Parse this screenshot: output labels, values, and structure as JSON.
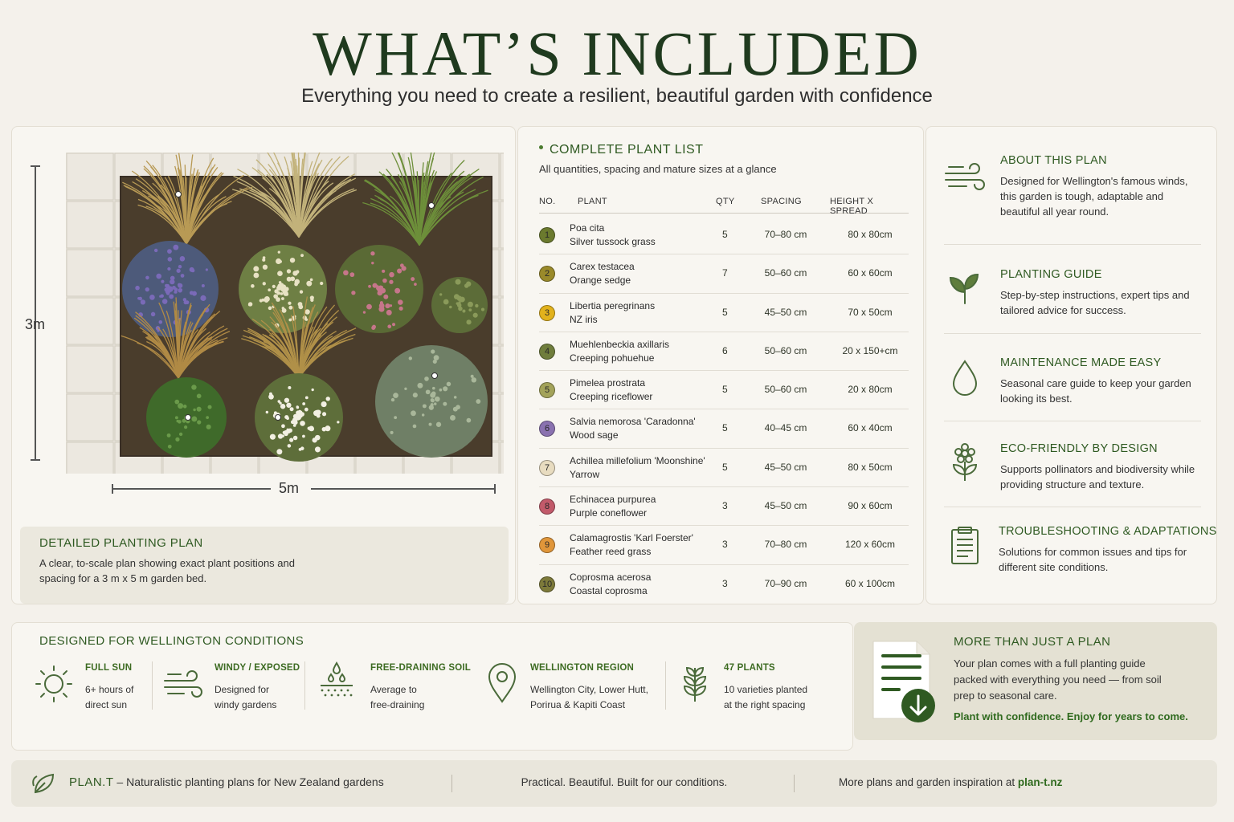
{
  "header": {
    "title": "WHAT’S INCLUDED",
    "subtitle": "Everything you need to create a resilient, beautiful garden with confidence"
  },
  "plan": {
    "dim_vertical": "3m",
    "dim_horizontal": "5m",
    "caption_title": "DETAILED PLANTING PLAN",
    "caption_text": "A clear, to-scale plan showing exact plant positions and spacing for a 3 m x 5 m garden bed."
  },
  "plant_list": {
    "title": "COMPLETE PLANT LIST",
    "subtitle": "All quantities, spacing and mature sizes at a glance",
    "columns": [
      "NO.",
      "PLANT",
      "QTY",
      "SPACING",
      "HEIGHT X SPREAD"
    ],
    "rows": [
      {
        "no": "1",
        "name": "Poa cita",
        "common": "Silver tussock grass",
        "qty": "5",
        "spacing": "70–80 cm",
        "size": "80 x 80cm",
        "color": "#6b7a2e"
      },
      {
        "no": "2",
        "name": "Carex testacea",
        "common": "Orange sedge",
        "qty": "7",
        "spacing": "50–60 cm",
        "size": "60 x 60cm",
        "color": "#9a8a2a"
      },
      {
        "no": "3",
        "name": "Libertia peregrinans",
        "common": "NZ iris",
        "qty": "5",
        "spacing": "45–50 cm",
        "size": "70 x 50cm",
        "color": "#e2b21c"
      },
      {
        "no": "4",
        "name": "Muehlenbeckia axillaris",
        "common": "Creeping pohuehue",
        "qty": "6",
        "spacing": "50–60 cm",
        "size": "20 x 150+cm",
        "color": "#6f7d3c"
      },
      {
        "no": "5",
        "name": "Pimelea prostrata",
        "common": "Creeping riceflower",
        "qty": "5",
        "spacing": "50–60 cm",
        "size": "20 x 80cm",
        "color": "#a3a35a"
      },
      {
        "no": "6",
        "name": "Salvia nemorosa 'Caradonna'",
        "common": "Wood sage",
        "qty": "5",
        "spacing": "40–45 cm",
        "size": "60 x 40cm",
        "color": "#8a72b0"
      },
      {
        "no": "7",
        "name": "Achillea millefolium 'Moonshine'",
        "common": "Yarrow",
        "qty": "5",
        "spacing": "45–50 cm",
        "size": "80 x 50cm",
        "color": "#e8dcc0"
      },
      {
        "no": "8",
        "name": "Echinacea purpurea",
        "common": "Purple coneflower",
        "qty": "3",
        "spacing": "45–50 cm",
        "size": "90 x 60cm",
        "color": "#c25a6a"
      },
      {
        "no": "9",
        "name": "Calamagrostis 'Karl Foerster'",
        "common": "Feather reed grass",
        "qty": "3",
        "spacing": "70–80 cm",
        "size": "120 x 60cm",
        "color": "#e0963a"
      },
      {
        "no": "10",
        "name": "Coprosma acerosa",
        "common": "Coastal coprosma",
        "qty": "3",
        "spacing": "70–90 cm",
        "size": "60 x 100cm",
        "color": "#7d7a3a"
      }
    ]
  },
  "about": [
    {
      "icon": "wind-icon",
      "title": "ABOUT THIS PLAN",
      "text": "Designed for Wellington's famous winds, this garden is tough, adaptable and beautiful all year round."
    },
    {
      "icon": "sprout-icon",
      "title": "PLANTING GUIDE",
      "text": "Step-by-step instructions, expert tips and tailored advice for success."
    },
    {
      "icon": "water-drop-icon",
      "title": "MAINTENANCE MADE EASY",
      "text": "Seasonal care guide to keep your garden looking its best."
    },
    {
      "icon": "flower-icon",
      "title": "ECO-FRIENDLY BY DESIGN",
      "text": "Supports pollinators and biodiversity while providing structure and texture."
    },
    {
      "icon": "clipboard-icon",
      "title": "TROUBLESHOOTING & ADAPTATIONS",
      "text": "Solutions for common issues and tips for different site conditions."
    }
  ],
  "conditions": {
    "title": "DESIGNED FOR WELLINGTON CONDITIONS",
    "items": [
      {
        "icon": "sun-icon",
        "title": "FULL SUN",
        "line1": "6+ hours of",
        "line2": "direct sun"
      },
      {
        "icon": "wind-icon",
        "title": "WINDY / EXPOSED",
        "line1": "Designed for",
        "line2": "windy gardens"
      },
      {
        "icon": "soil-drainage-icon",
        "title": "FREE-DRAINING SOIL",
        "line1": "Average to",
        "line2": "free-draining"
      },
      {
        "icon": "location-pin-icon",
        "title": "WELLINGTON REGION",
        "line1": "Wellington City, Lower Hutt,",
        "line2": "Porirua & Kapiti Coast"
      },
      {
        "icon": "seedling-icon",
        "title": "47 PLANTS",
        "line1": "10 varieties planted",
        "line2": "at the right spacing"
      }
    ]
  },
  "more": {
    "title": "MORE THAN JUST A PLAN",
    "text": "Your plan comes with a full planting guide packed with everything you need — from soil prep to seasonal care.",
    "tagline": "Plant with confidence. Enjoy for years to come."
  },
  "footer": {
    "brand": "PLAN.T",
    "tagline": " – Naturalistic planting plans for New Zealand gardens",
    "middle": "Practical. Beautiful. Built for our conditions.",
    "right_text": "More plans and garden inspiration at ",
    "link": "plan-t.nz"
  },
  "colors": {
    "accent": "#2f5a22",
    "background": "#f4f1eb",
    "card": "#f8f6f1"
  }
}
